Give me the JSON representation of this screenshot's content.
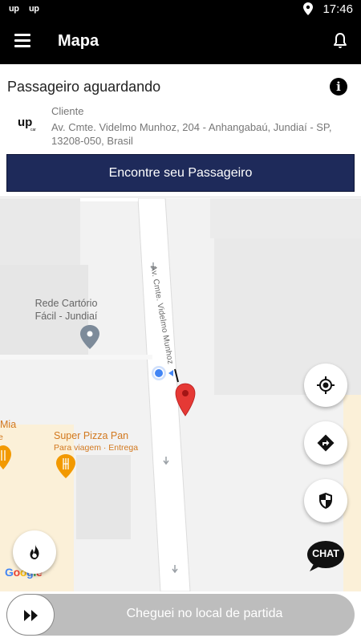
{
  "statusbar": {
    "app_logo_1": "up",
    "app_logo_2": "up",
    "location_icon": "location-pin-icon",
    "time": "17:46"
  },
  "appbar": {
    "menu_icon": "hamburger-menu-icon",
    "title": "Mapa",
    "bell_icon": "notification-bell-icon"
  },
  "card": {
    "heading": "Passageiro aguardando",
    "info_icon_glyph": "i",
    "brand_logo": "up",
    "client_label": "Cliente",
    "address": "Av. Cmte. Videlmo Munhoz, 204 - Anhangabaú, Jundiaí - SP, 13208-050, Brasil",
    "find_button": "Encontre seu Passageiro",
    "find_button_color": "#1e2a5a"
  },
  "map": {
    "street_name": "Av. Cmte. Videlmo Munhoz",
    "poi_cartorio_line1": "Rede Cartório",
    "poi_cartorio_line2": "Fácil - Jundiaí",
    "poi_mia": "Mia",
    "poi_pizza_name": "Super Pizza Pan",
    "poi_pizza_sub": "Para viagem · Entrega",
    "google_logo": "Google",
    "pin_color": "#e53935",
    "user_dot_color": "#4285f4"
  },
  "fabs": {
    "recenter": "my-location-icon",
    "directions": "directions-icon",
    "security": "shield-icon",
    "heatmap": "flame-icon",
    "chat_label": "CHAT"
  },
  "bottom": {
    "slide_label": "Cheguei no local de partida",
    "knob_icon": "fast-forward-icon"
  }
}
